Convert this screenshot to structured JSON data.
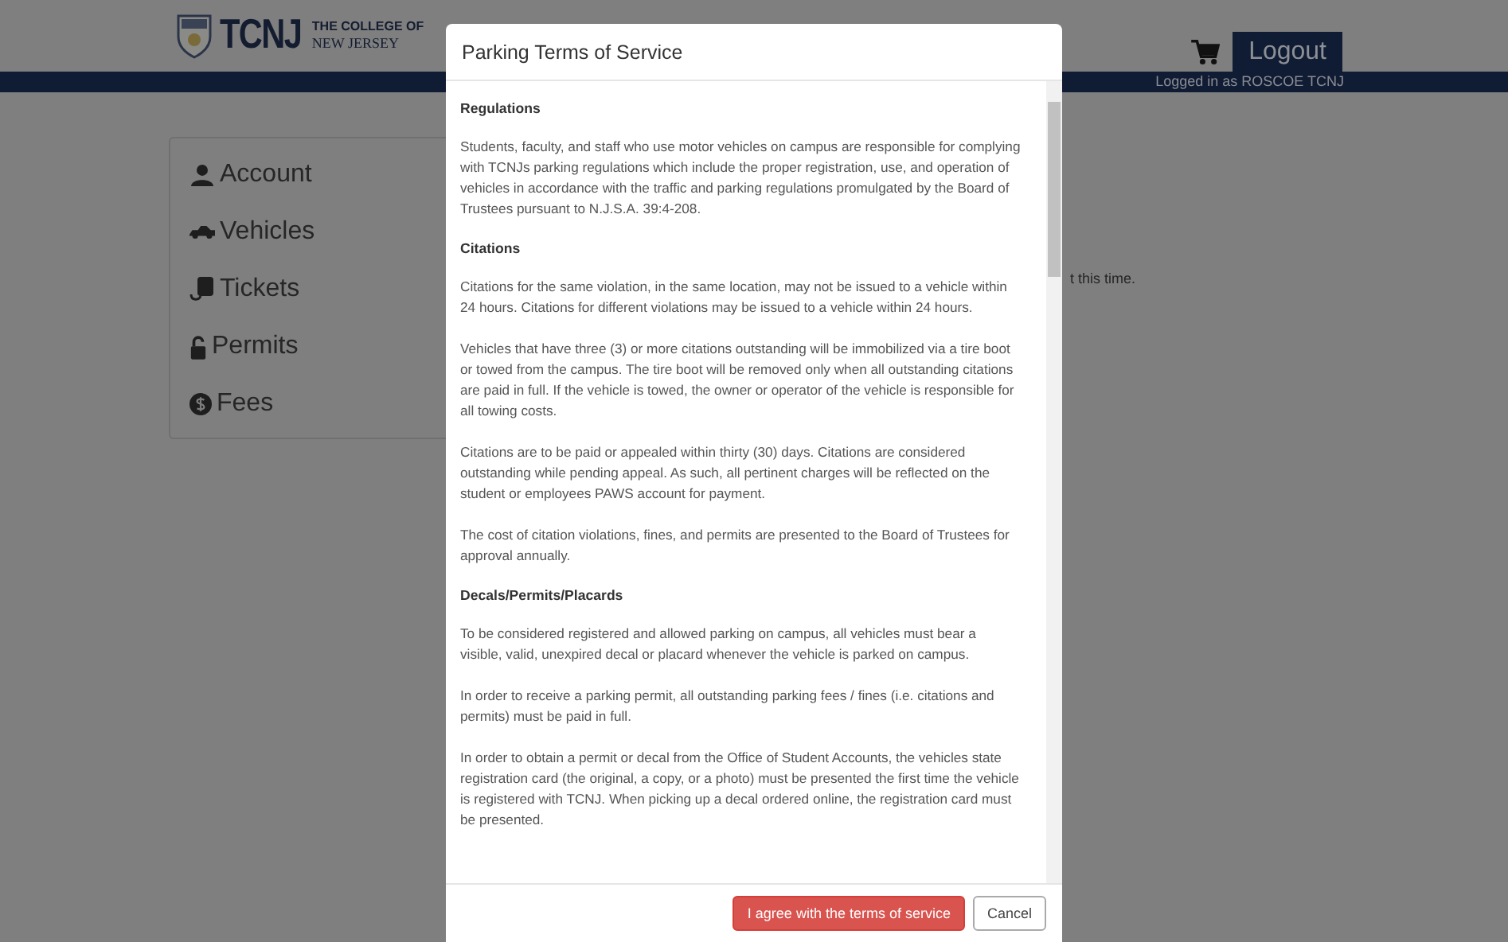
{
  "header": {
    "logo_mark": "TCNJ",
    "logo_line_1": "THE COLLEGE OF",
    "logo_line_2": "NEW JERSEY",
    "logout": "Logout",
    "logged_in": "Logged in as ROSCOE TCNJ"
  },
  "sidebar": {
    "items": [
      {
        "kind": "account",
        "label": "Account"
      },
      {
        "kind": "vehicles",
        "label": "Vehicles"
      },
      {
        "kind": "tickets",
        "label": "Tickets"
      },
      {
        "kind": "permits",
        "label": "Permits"
      },
      {
        "kind": "fees",
        "label": "Fees"
      }
    ]
  },
  "main": {
    "message": "t this time."
  },
  "modal": {
    "title": "Parking Terms of Service",
    "blocks": [
      {
        "kind": "heading",
        "text": "Regulations"
      },
      {
        "kind": "paragraph",
        "text": "Students, faculty, and staff who use motor vehicles on campus are responsible for complying with TCNJs parking regulations which include the proper registration, use, and operation of vehicles in accordance with the traffic and parking regulations promulgated by the Board of Trustees pursuant to N.J.S.A. 39:4-208."
      },
      {
        "kind": "heading",
        "text": "Citations"
      },
      {
        "kind": "paragraph",
        "text": "Citations for the same violation, in the same location, may not be issued to a vehicle within 24 hours. Citations for different violations may be issued to a vehicle within 24 hours."
      },
      {
        "kind": "paragraph",
        "text": "Vehicles that have three (3) or more citations outstanding will be immobilized via a tire boot or towed from the campus. The tire boot will be removed only when all outstanding citations are paid in full. If the vehicle is towed, the owner or operator of the vehicle is responsible for all towing costs."
      },
      {
        "kind": "paragraph",
        "text": "Citations are to be paid or appealed within thirty (30) days. Citations are considered outstanding while pending appeal. As such, all pertinent charges will be reflected on the student or employees PAWS account for payment."
      },
      {
        "kind": "paragraph",
        "text": "The cost of citation violations, fines, and permits are presented to the Board of Trustees for approval annually."
      },
      {
        "kind": "heading",
        "text": "Decals/Permits/Placards"
      },
      {
        "kind": "paragraph",
        "text": "To be considered registered and allowed parking on campus, all vehicles must bear a visible, valid, unexpired decal or placard whenever the vehicle is parked on campus."
      },
      {
        "kind": "paragraph",
        "text": "In order to receive a parking permit, all outstanding parking fees / fines (i.e. citations and permits) must be paid in full."
      },
      {
        "kind": "paragraph",
        "text": "In order to obtain a permit or decal from the Office of Student Accounts, the vehicles state registration card (the original, a copy, or a photo) must be presented the first time the vehicle is registered with TCNJ. When picking up a decal ordered online, the registration card must be presented."
      }
    ],
    "agree": "I agree with the terms of service",
    "cancel": "Cancel"
  }
}
